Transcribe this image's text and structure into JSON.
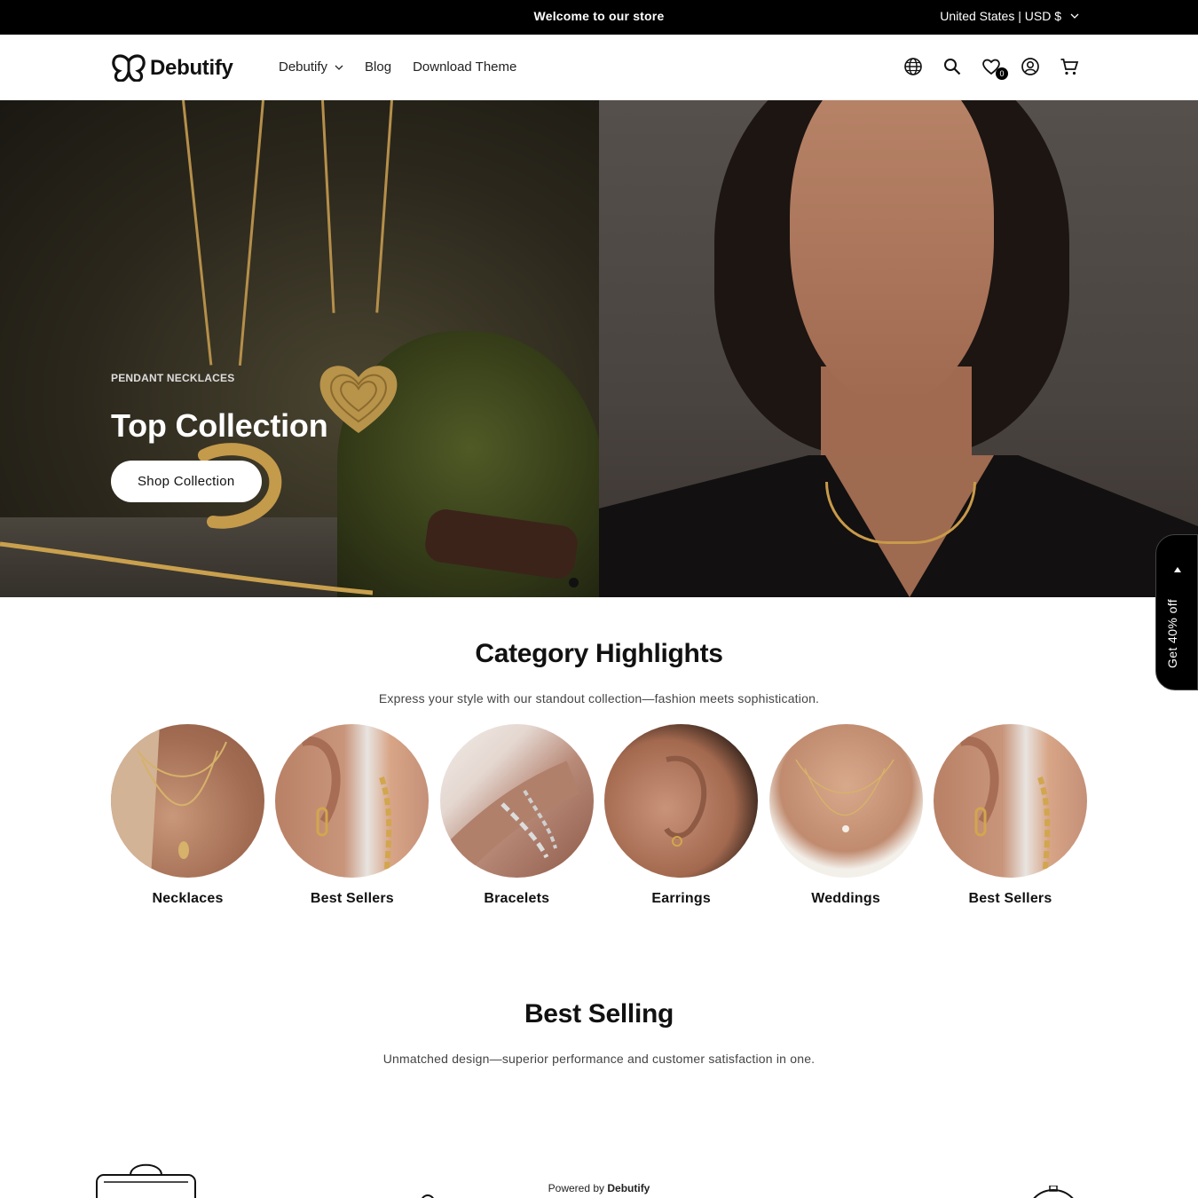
{
  "announcement": {
    "message": "Welcome to our store",
    "locale": "United States | USD $"
  },
  "header": {
    "logo_text": "Debutify",
    "nav": [
      {
        "label": "Debutify",
        "has_dropdown": true
      },
      {
        "label": "Blog",
        "has_dropdown": false
      },
      {
        "label": "Download Theme",
        "has_dropdown": false
      }
    ],
    "icons": [
      "globe-icon",
      "search-icon",
      "wishlist-heart-icon",
      "account-icon",
      "cart-icon"
    ],
    "wishlist_count": "0"
  },
  "hero": {
    "eyebrow": "PENDANT NECKLACES",
    "title": "Top Collection",
    "button_label": "Shop Collection"
  },
  "side_tab": {
    "label": "Get 40% off"
  },
  "categories": {
    "title": "Category Highlights",
    "subtitle": "Express your style with our standout collection—fashion meets sophistication.",
    "items": [
      {
        "label": "Necklaces"
      },
      {
        "label": "Best Sellers"
      },
      {
        "label": "Bracelets"
      },
      {
        "label": "Earrings"
      },
      {
        "label": "Weddings"
      },
      {
        "label": "Best Sellers"
      }
    ]
  },
  "best_selling": {
    "title": "Best Selling",
    "subtitle": "Unmatched design—superior performance and customer satisfaction in one."
  },
  "footer": {
    "powered_prefix": "Powered by",
    "powered_brand": "Debutify"
  },
  "colors": {
    "announcement_bg": "#000000",
    "text": "#111111",
    "button_bg": "#ffffff"
  }
}
